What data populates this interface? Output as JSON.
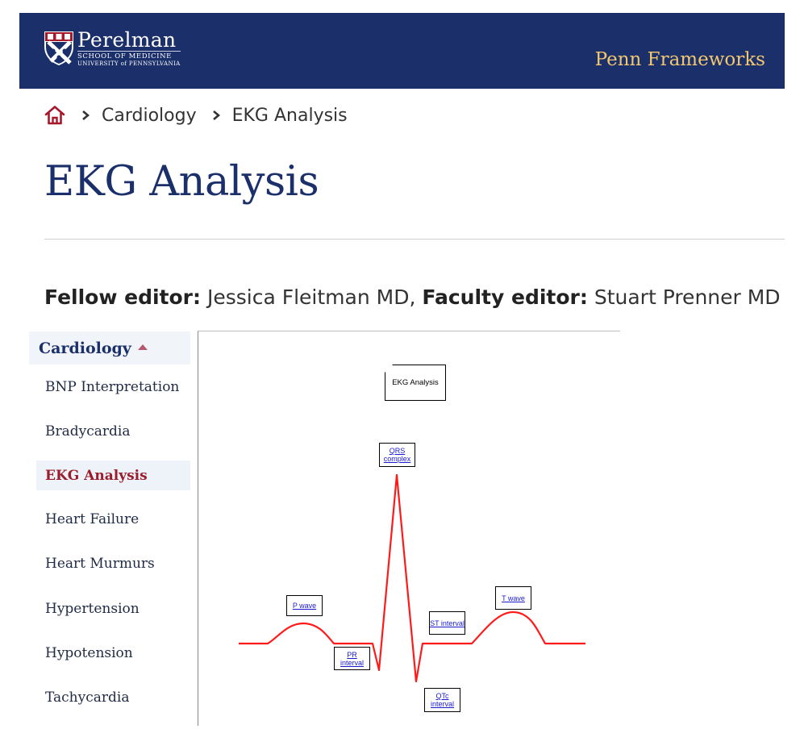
{
  "header": {
    "logo_main": "Perelman",
    "logo_sub1": "SCHOOL OF MEDICINE",
    "logo_sub2": "UNIVERSITY of PENNSYLVANIA",
    "brand": "Penn Frameworks"
  },
  "breadcrumb": {
    "items": [
      "Cardiology",
      "EKG Analysis"
    ]
  },
  "page": {
    "title": "EKG Analysis"
  },
  "editors": {
    "fellow_label": "Fellow editor:",
    "fellow_name": "Jessica Fleitman MD,",
    "faculty_label": "Faculty editor:",
    "faculty_name": "Stuart Prenner MD"
  },
  "sidebar": {
    "header": "Cardiology",
    "items": [
      "BNP Interpretation",
      "Bradycardia",
      "EKG Analysis",
      "Heart Failure",
      "Heart Murmurs",
      "Hypertension",
      "Hypotension",
      "Tachycardia"
    ],
    "active_index": 2
  },
  "diagram": {
    "title": "EKG Analysis",
    "labels": {
      "qrs": "QRS complex",
      "p_wave": "P wave",
      "pr_interval": "PR interval",
      "st_interval": "ST interval",
      "t_wave": "T wave",
      "qtc_interval": "QTc interval"
    },
    "trace_color": "#ff1a1a"
  },
  "colors": {
    "header_bg": "#1b2f6b",
    "brand_text": "#f2c76e",
    "title": "#1b2f6b",
    "active_item": "#9b1c2c",
    "link": "#1a1ad0"
  }
}
